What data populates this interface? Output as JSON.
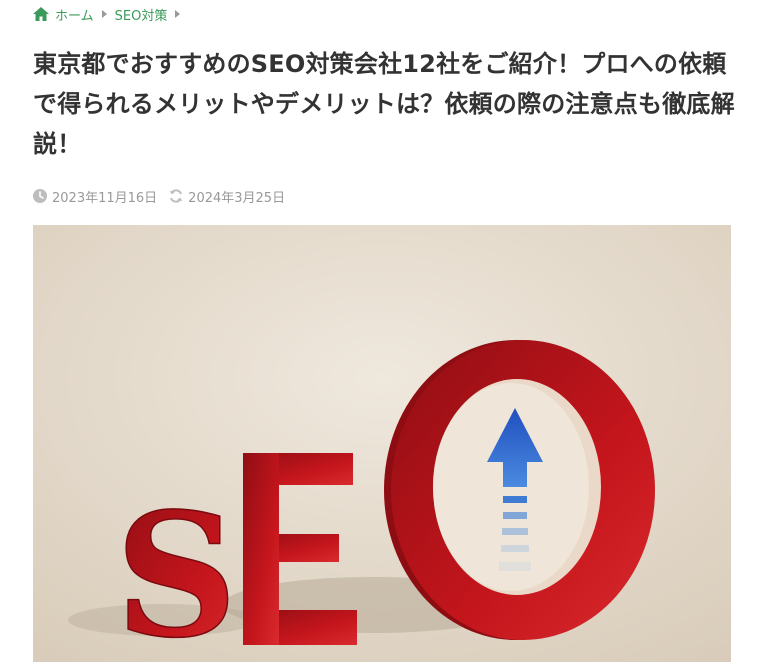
{
  "breadcrumb": {
    "items": [
      {
        "label": "ホーム",
        "icon": "home-icon"
      },
      {
        "label": "SEO対策"
      }
    ]
  },
  "article": {
    "title": "東京都でおすすめのSEO対策会社12社をご紹介！プロへの依頼で得られるメリットやデメリットは？依頼の際の注意点も徹底解説！",
    "published_date": "2023年11月16日",
    "updated_date": "2024年3月25日"
  },
  "hero": {
    "text": "SEO",
    "colors": {
      "background": "#e6dccd",
      "letter": "#c0141b",
      "arrow": "#2f6fd6"
    }
  },
  "colors": {
    "accent": "#3a9a5a",
    "title": "#333333",
    "meta": "#999999"
  }
}
